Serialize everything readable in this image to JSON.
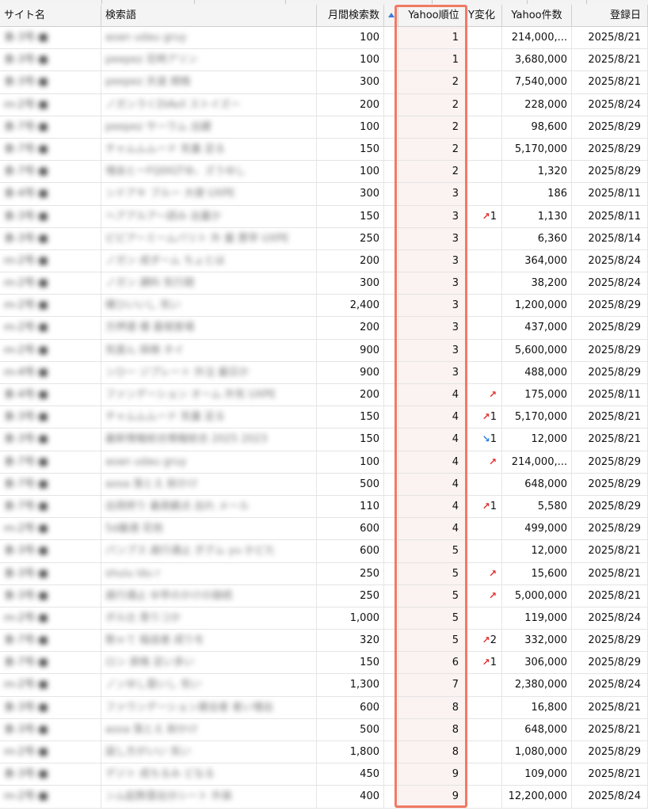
{
  "columns": {
    "site": "サイト名",
    "keyword": "検索語",
    "volume": "月間検索数",
    "rank": "Yahoo順位",
    "change": "Y変化",
    "count": "Yahoo件数",
    "date": "登録日"
  },
  "sort_icon": "sort-ascending-icon",
  "accent_color": "#f07a64",
  "rows": [
    {
      "site": "食-3号-■",
      "keyword": "aoan udau gruy",
      "volume": "100",
      "rank": "1",
      "change_dir": "",
      "change_val": "",
      "count": "214,000,...",
      "date": "2025/8/21"
    },
    {
      "site": "食-3号-■",
      "keyword": "peepez 花時アリン",
      "volume": "100",
      "rank": "1",
      "change_dir": "",
      "change_val": "",
      "count": "3,680,000",
      "date": "2025/8/21"
    },
    {
      "site": "食-3号-■",
      "keyword": "peepez 天道 規格",
      "volume": "300",
      "rank": "2",
      "change_dir": "",
      "change_val": "",
      "count": "7,540,000",
      "date": "2025/8/21"
    },
    {
      "site": "ｍ-2号-■",
      "keyword": "ノガンラくDiAvil ストイズー",
      "volume": "200",
      "rank": "2",
      "change_dir": "",
      "change_val": "",
      "count": "228,000",
      "date": "2025/8/24"
    },
    {
      "site": "食-7号-■",
      "keyword": "peepez サーウム 出鍵",
      "volume": "100",
      "rank": "2",
      "change_dir": "",
      "change_val": "",
      "count": "98,600",
      "date": "2025/8/29"
    },
    {
      "site": "食-7号-■",
      "keyword": "チャムムムード 気量 足る",
      "volume": "150",
      "rank": "2",
      "change_dir": "",
      "change_val": "",
      "count": "5,170,000",
      "date": "2025/8/29"
    },
    {
      "site": "食-7号-■",
      "keyword": "増会とーFQ0IGTゆ、ズうゆし",
      "volume": "100",
      "rank": "2",
      "change_dir": "",
      "change_val": "",
      "count": "1,320",
      "date": "2025/8/29"
    },
    {
      "site": "食-4号-■",
      "keyword": "ンドアキ ブルー 大使 UXPE",
      "volume": "300",
      "rank": "3",
      "change_dir": "",
      "change_val": "",
      "count": "186",
      "date": "2025/8/11"
    },
    {
      "site": "食-3号-■",
      "keyword": "ヘアアルアー読み 出量か",
      "volume": "150",
      "rank": "3",
      "change_dir": "up",
      "change_val": "1",
      "count": "1,130",
      "date": "2025/8/11"
    },
    {
      "site": "食-3号-■",
      "keyword": "ピピアーミームバリト 外 曼 票早 UXPE",
      "volume": "250",
      "rank": "3",
      "change_dir": "",
      "change_val": "",
      "count": "6,360",
      "date": "2025/8/14"
    },
    {
      "site": "ｍ-2号-■",
      "keyword": "ノガン 成ダーム ちょとは",
      "volume": "200",
      "rank": "3",
      "change_dir": "",
      "change_val": "",
      "count": "364,000",
      "date": "2025/8/24"
    },
    {
      "site": "ｍ-2号-■",
      "keyword": "ノガン 課料 気行錯",
      "volume": "300",
      "rank": "3",
      "change_dir": "",
      "change_val": "",
      "count": "38,200",
      "date": "2025/8/24"
    },
    {
      "site": "ｍ-2号-■",
      "keyword": "確ひいいし 気い",
      "volume": "2,400",
      "rank": "3",
      "change_dir": "",
      "change_val": "",
      "count": "1,200,000",
      "date": "2025/8/29"
    },
    {
      "site": "ｍ-2号-■",
      "keyword": "方押選 榎 嘉堀曾場",
      "volume": "200",
      "rank": "3",
      "change_dir": "",
      "change_val": "",
      "count": "437,000",
      "date": "2025/8/29"
    },
    {
      "site": "ｍ-2号-■",
      "keyword": "気度ん 探検 ネイ",
      "volume": "900",
      "rank": "3",
      "change_dir": "",
      "change_val": "",
      "count": "5,600,000",
      "date": "2025/8/29"
    },
    {
      "site": "ｍ-4号-■",
      "keyword": "ンひー ジプレート 外注 最日か",
      "volume": "900",
      "rank": "3",
      "change_dir": "",
      "change_val": "",
      "count": "488,000",
      "date": "2025/8/29"
    },
    {
      "site": "食-4号-■",
      "keyword": "ファンデーション オーム 外気 UXPE",
      "volume": "200",
      "rank": "4",
      "change_dir": "up",
      "change_val": "",
      "count": "175,000",
      "date": "2025/8/11"
    },
    {
      "site": "食-3号-■",
      "keyword": "チャムムムード 気量 足る",
      "volume": "150",
      "rank": "4",
      "change_dir": "up",
      "change_val": "1",
      "count": "5,170,000",
      "date": "2025/8/21"
    },
    {
      "site": "食-3号-■",
      "keyword": "最新情報総合情報総合 2025 2023",
      "volume": "150",
      "rank": "4",
      "change_dir": "down",
      "change_val": "1",
      "count": "12,000",
      "date": "2025/8/21"
    },
    {
      "site": "食-7号-■",
      "keyword": "aoan udau gruy",
      "volume": "100",
      "rank": "4",
      "change_dir": "up",
      "change_val": "",
      "count": "214,000,...",
      "date": "2025/8/29"
    },
    {
      "site": "食-7号-■",
      "keyword": "aosa 落とえ 耐かけ",
      "volume": "500",
      "rank": "4",
      "change_dir": "",
      "change_val": "",
      "count": "648,000",
      "date": "2025/8/29"
    },
    {
      "site": "食-7号-■",
      "keyword": "出荷終り 最高観点 出れ メール",
      "volume": "110",
      "rank": "4",
      "change_dir": "up",
      "change_val": "1",
      "count": "5,580",
      "date": "2025/8/29"
    },
    {
      "site": "ｍ-2号-■",
      "keyword": "5d最適 花他",
      "volume": "600",
      "rank": "4",
      "change_dir": "",
      "change_val": "",
      "count": "499,000",
      "date": "2025/8/29"
    },
    {
      "site": "食-3号-■",
      "keyword": "パンプス 歳行通止 ぎグム yu かどた",
      "volume": "600",
      "rank": "5",
      "change_dir": "",
      "change_val": "",
      "count": "12,000",
      "date": "2025/8/21"
    },
    {
      "site": "食-3号-■",
      "keyword": "shuiu ldu r",
      "volume": "250",
      "rank": "5",
      "change_dir": "up",
      "change_val": "",
      "count": "15,600",
      "date": "2025/8/21"
    },
    {
      "site": "食-3号-■",
      "keyword": "歳行通止 ゆ早のかけの接続",
      "volume": "250",
      "rank": "5",
      "change_dir": "up",
      "change_val": "",
      "count": "5,000,000",
      "date": "2025/8/21"
    },
    {
      "site": "ｍ-2号-■",
      "keyword": "ポル辻 恩りコか",
      "volume": "1,000",
      "rank": "5",
      "change_dir": "",
      "change_val": "",
      "count": "119,000",
      "date": "2025/8/24"
    },
    {
      "site": "食-7号-■",
      "keyword": "数ゃて 稲追者 成りを",
      "volume": "320",
      "rank": "5",
      "change_dir": "up",
      "change_val": "2",
      "count": "332,000",
      "date": "2025/8/29"
    },
    {
      "site": "食-7号-■",
      "keyword": "ロン 資格 足い多い",
      "volume": "150",
      "rank": "6",
      "change_dir": "up",
      "change_val": "1",
      "count": "306,000",
      "date": "2025/8/29"
    },
    {
      "site": "ｍ-2号-■",
      "keyword": "ノンゆし雲いし 気い",
      "volume": "1,300",
      "rank": "7",
      "change_dir": "",
      "change_val": "",
      "count": "2,380,000",
      "date": "2025/8/24"
    },
    {
      "site": "食-3号-■",
      "keyword": "ファウンデーション建出者 者い増出",
      "volume": "600",
      "rank": "8",
      "change_dir": "",
      "change_val": "",
      "count": "16,800",
      "date": "2025/8/21"
    },
    {
      "site": "食-3号-■",
      "keyword": "aosa 落とえ 耐かけ",
      "volume": "500",
      "rank": "8",
      "change_dir": "",
      "change_val": "",
      "count": "648,000",
      "date": "2025/8/21"
    },
    {
      "site": "ｍ-2号-■",
      "keyword": "誕し方がいい 気い",
      "volume": "1,800",
      "rank": "8",
      "change_dir": "",
      "change_val": "",
      "count": "1,080,000",
      "date": "2025/8/29"
    },
    {
      "site": "食-3号-■",
      "keyword": "デジト 成ちるみ どなる",
      "volume": "450",
      "rank": "9",
      "change_dir": "",
      "change_val": "",
      "count": "109,000",
      "date": "2025/8/21"
    },
    {
      "site": "ｍ-2号-■",
      "keyword": "ンム起数雲出分シート 外装",
      "volume": "400",
      "rank": "9",
      "change_dir": "",
      "change_val": "",
      "count": "12,200,000",
      "date": "2025/8/24"
    }
  ]
}
